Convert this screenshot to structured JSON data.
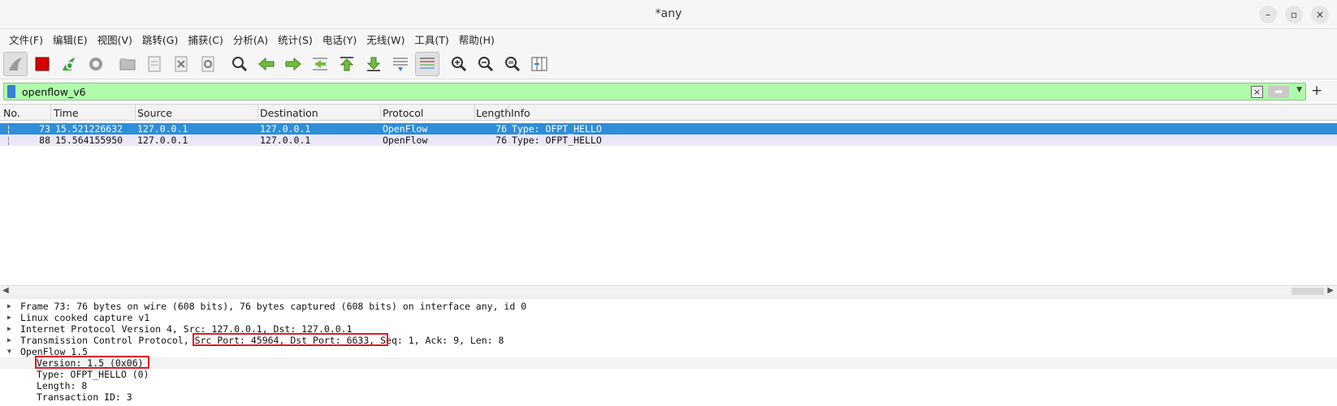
{
  "window": {
    "title": "*any",
    "minimize": "–",
    "maximize": "▫",
    "close": "×"
  },
  "menu": [
    "文件(F)",
    "编辑(E)",
    "视图(V)",
    "跳转(G)",
    "捕获(C)",
    "分析(A)",
    "统计(S)",
    "电话(Y)",
    "无线(W)",
    "工具(T)",
    "帮助(H)"
  ],
  "filter": {
    "value": "openflow_v6",
    "add": "+"
  },
  "columns": {
    "no": "No.",
    "time": "Time",
    "source": "Source",
    "destination": "Destination",
    "protocol": "Protocol",
    "length": "Length",
    "info": "Info"
  },
  "packets": [
    {
      "no": "73",
      "time": "15.521226632",
      "source": "127.0.0.1",
      "destination": "127.0.0.1",
      "protocol": "OpenFlow",
      "length": "76",
      "info": "Type: OFPT_HELLO"
    },
    {
      "no": "88",
      "time": "15.564155950",
      "source": "127.0.0.1",
      "destination": "127.0.0.1",
      "protocol": "OpenFlow",
      "length": "76",
      "info": "Type: OFPT_HELLO"
    }
  ],
  "details": {
    "frame": "Frame 73: 76 bytes on wire (608 bits), 76 bytes captured (608 bits) on interface any, id 0",
    "linux": "Linux cooked capture v1",
    "ip": "Internet Protocol Version 4, Src: 127.0.0.1, Dst: 127.0.0.1",
    "tcp": "Transmission Control Protocol, Src Port: 45964, Dst Port: 6633, Seq: 1, Ack: 9, Len: 8",
    "openflow": "OpenFlow 1.5",
    "version": "Version: 1.5 (0x06)",
    "type": "Type: OFPT_HELLO (0)",
    "length": "Length: 8",
    "xid": "Transaction ID: 3"
  },
  "colors": {
    "selected_row": "#2f8ed8",
    "normal_row": "#ece7f8",
    "filter_bg": "#aefbaa",
    "highlight_box": "#e3191f"
  }
}
